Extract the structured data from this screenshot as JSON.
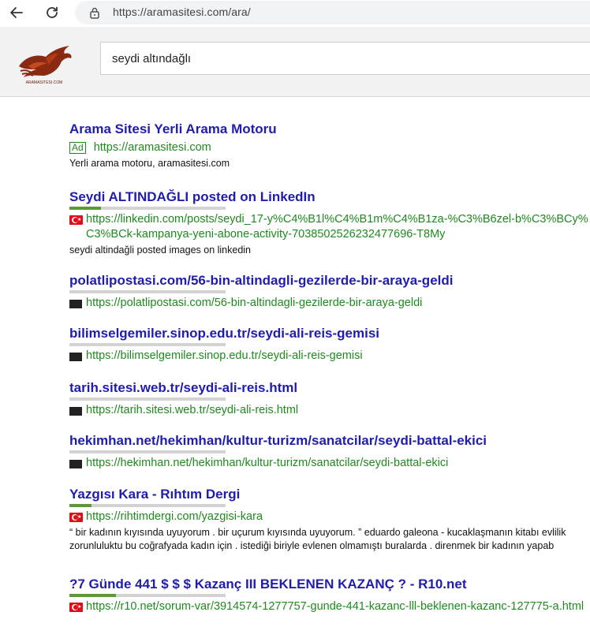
{
  "browser": {
    "url": "https://aramasitesi.com/ara/"
  },
  "search": {
    "query": "seydi altındağlı"
  },
  "logo": {
    "text": "ARAMASITESI.COM"
  },
  "ad": {
    "title": "Arama Sitesi Yerli Arama Motoru",
    "badge": "Ad",
    "url": "https://aramasitesi.com",
    "snippet": "Yerli arama motoru, aramasitesi.com"
  },
  "results": [
    {
      "title": "Seydi ALTINDAĞLI posted on LinkedIn",
      "url": "https://linkedin.com/posts/seydi_17-y%C4%B1l%C4%B1m%C4%B1za-%C3%B6zel-b%C3%BCy%C3%BCk-kampanya-yeni-abone-activity-7038502526232477696-T8My",
      "snippet": "seydi altindağli posted images on linkedin",
      "flag": "turkey-flag",
      "score": 0.2
    },
    {
      "title": "polatlipostasi.com/56-bin-altindagli-gezilerde-bir-araya-geldi",
      "url": "https://polatlipostasi.com/56-bin-altindagli-gezilerde-bir-araya-geldi",
      "snippet": "",
      "flag": "square-icon",
      "score": 0
    },
    {
      "title": "bilimselgemiler.sinop.edu.tr/seydi-ali-reis-gemisi",
      "url": "https://bilimselgemiler.sinop.edu.tr/seydi-ali-reis-gemisi",
      "snippet": "",
      "flag": "square-icon",
      "score": 0
    },
    {
      "title": "tarih.sitesi.web.tr/seydi-ali-reis.html",
      "url": "https://tarih.sitesi.web.tr/seydi-ali-reis.html",
      "snippet": "",
      "flag": "square-icon",
      "score": 0
    },
    {
      "title": "hekimhan.net/hekimhan/kultur-turizm/sanatcilar/seydi-battal-ekici",
      "url": "https://hekimhan.net/hekimhan/kultur-turizm/sanatcilar/seydi-battal-ekici",
      "snippet": "",
      "flag": "square-icon",
      "score": 0
    },
    {
      "title": "Yazgısı Kara - Rıhtım Dergi",
      "url": "https://rihtimdergi.com/yazgisi-kara",
      "snippet": "“ bir kadının kıyısında uyuyorum . bir uçurum kıyısında uyuyorum. ” eduardo galeona - kucaklaşmanın kitabı evlilik zorunluluktu bu coğrafyada kadın için . istediği biriyle evlenen olmamıştı buralarda . direnmek bir kadının yapab",
      "flag": "turkey-flag",
      "score": 0.14
    },
    {
      "title": "?7 Günde 441 $ $ $ Kazanç III BEKLENEN KAZANÇ ? - R10.net",
      "url": "https://r10.net/sorum-var/3914574-1277757-gunde-441-kazanc-lll-beklenen-kazanc-127775-a.html",
      "snippet": "",
      "flag": "turkey-flag",
      "score": 0.3
    }
  ]
}
